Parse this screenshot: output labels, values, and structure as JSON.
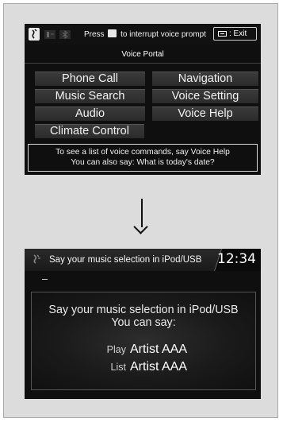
{
  "voice_portal": {
    "hint_prefix": "Press",
    "hint_suffix": "to interrupt voice prompt",
    "exit_label": ": Exit",
    "title": "Voice Portal",
    "buttons": [
      "Phone Call",
      "Navigation",
      "Music Search",
      "Voice Setting",
      "Audio",
      "Voice Help",
      "Climate Control"
    ],
    "help_line1": "To see a list of voice commands, say Voice Help",
    "help_line2": "You can also say: What is today's date?"
  },
  "music_screen": {
    "title": "Say your music selection in iPod/USB",
    "clock": "12:34",
    "prompt_line1": "Say your music selection in iPod/USB",
    "prompt_line2": "You can say:",
    "commands": [
      {
        "keyword": "Play",
        "value": "Artist AAA"
      },
      {
        "keyword": "List",
        "value": "Artist AAA"
      }
    ]
  }
}
